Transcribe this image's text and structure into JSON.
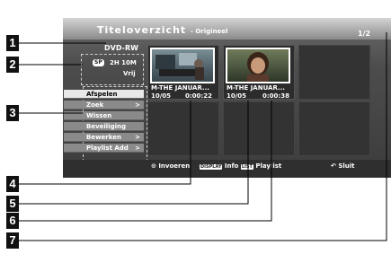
{
  "header": {
    "title": "Titeloverzicht",
    "subtitle": "- Origineel",
    "page": "1/2"
  },
  "disc": {
    "type": "DVD-RW",
    "mode_badge": "SP",
    "free_time": "2H 10M",
    "free_label": "Vrij"
  },
  "menu": {
    "items": [
      {
        "label": "Afspelen",
        "arrow": ""
      },
      {
        "label": "Zoek",
        "arrow": ">"
      },
      {
        "label": "Wissen",
        "arrow": ""
      },
      {
        "label": "Beveiliging",
        "arrow": ""
      },
      {
        "label": "Bewerken",
        "arrow": ">"
      },
      {
        "label": "Playlist Add",
        "arrow": ">"
      }
    ]
  },
  "titles": [
    {
      "name": "M-THE JANUAR...",
      "date": "10/05",
      "duration": "0:00:22"
    },
    {
      "name": "M-THE JANUAR...",
      "date": "10/05",
      "duration": "0:00:38"
    }
  ],
  "footer": {
    "enter": "Invoeren",
    "display_badge": "DISPLAY",
    "info": "Info",
    "list_badge": "LIST",
    "playlist": "Playlist",
    "close": "Sluit"
  },
  "callouts": [
    "1",
    "2",
    "3",
    "4",
    "5",
    "6",
    "7"
  ]
}
